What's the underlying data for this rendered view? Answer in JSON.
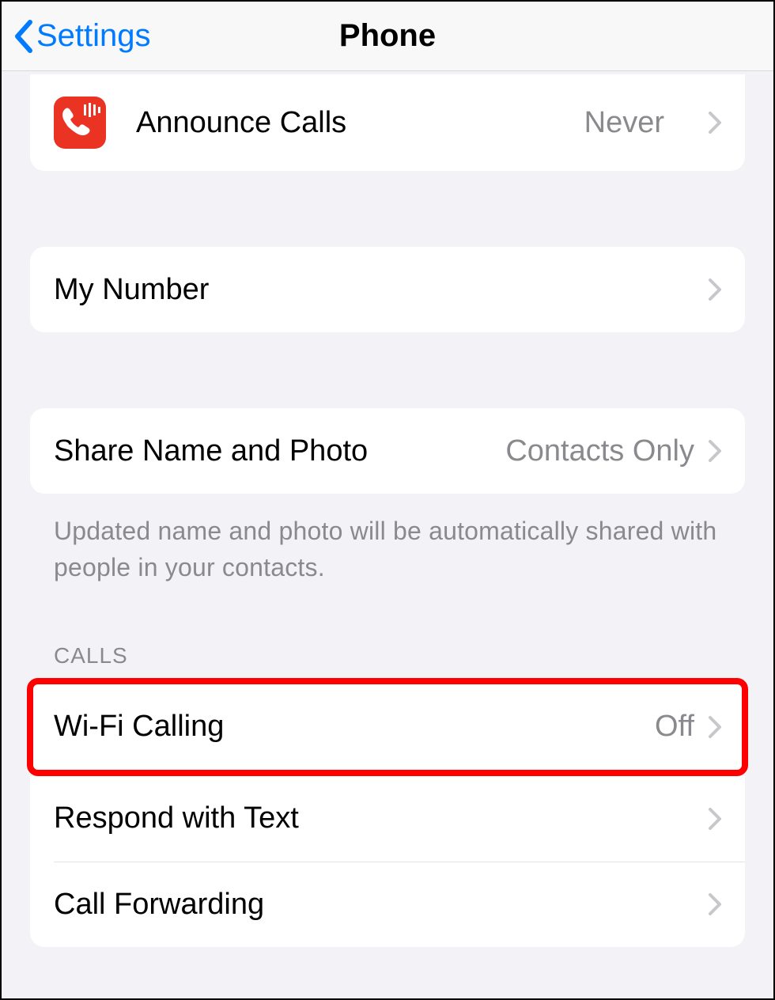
{
  "header": {
    "back_label": "Settings",
    "title": "Phone"
  },
  "rows": {
    "announce": {
      "label": "Announce Calls",
      "value": "Never"
    },
    "mynumber": {
      "label": "My Number"
    },
    "sharename": {
      "label": "Share Name and Photo",
      "value": "Contacts Only"
    },
    "sharename_footer": "Updated name and photo will be automatically shared with people in your contacts.",
    "calls_header": "CALLS",
    "wificalling": {
      "label": "Wi-Fi Calling",
      "value": "Off"
    },
    "respond": {
      "label": "Respond with Text"
    },
    "forwarding": {
      "label": "Call Forwarding"
    }
  }
}
